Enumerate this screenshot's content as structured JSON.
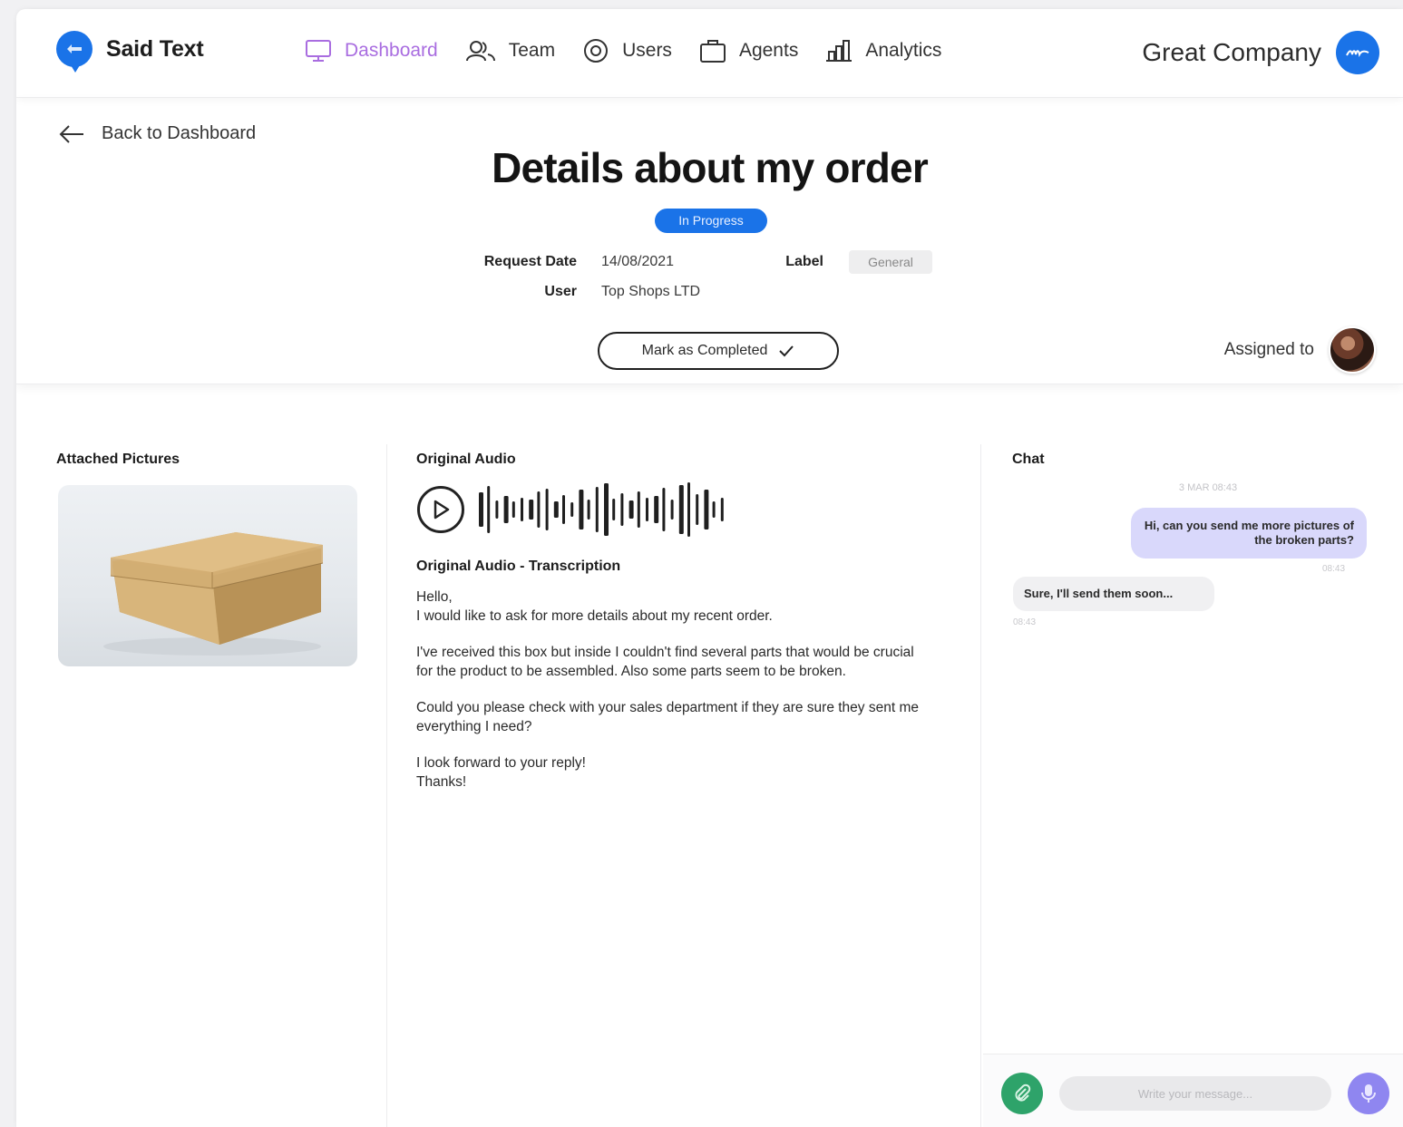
{
  "brand": {
    "name": "Said Text",
    "color": "#1a73e8"
  },
  "nav": {
    "items": [
      {
        "label": "Dashboard",
        "icon": "monitor-icon",
        "active": true
      },
      {
        "label": "Team",
        "icon": "team-icon"
      },
      {
        "label": "Users",
        "icon": "users-icon"
      },
      {
        "label": "Agents",
        "icon": "briefcase-icon"
      },
      {
        "label": "Analytics",
        "icon": "bar-chart-icon"
      }
    ],
    "active_color": "#a96de0"
  },
  "company": {
    "name": "Great Company"
  },
  "header": {
    "back_label": "Back to Dashboard",
    "title": "Details about my order",
    "status": "In Progress",
    "meta": {
      "request_date_label": "Request Date",
      "request_date": "14/08/2021",
      "label_label": "Label",
      "label_value": "General",
      "user_label": "User",
      "user_value": "Top Shops LTD"
    },
    "complete_button": "Mark as Completed",
    "assigned_label": "Assigned to"
  },
  "pictures": {
    "title": "Attached Pictures"
  },
  "audio": {
    "title": "Original Audio",
    "transcription_title": "Original Audio - Transcription",
    "transcription": [
      "Hello,",
      "I would like to ask for more details about my recent order.",
      "I've received this box but inside I couldn't find several parts that would be crucial for the product to be assembled. Also some parts seem to be broken.",
      "Could you please check with your sales department if they are sure they sent me everything I need?",
      "I look forward to your reply!",
      "Thanks!"
    ]
  },
  "chat": {
    "title": "Chat",
    "date": "3 MAR 08:43",
    "messages": [
      {
        "from": "agent",
        "text": "Hi, can you send me more pictures of the broken parts?",
        "time": "08:43"
      },
      {
        "from": "user",
        "text": "Sure, I'll send them soon...",
        "time": "08:43"
      }
    ],
    "input_placeholder": "Write your message...",
    "colors": {
      "outgoing": "#d9d8fb",
      "incoming": "#f0f0f2",
      "attach": "#2ea36a",
      "mic": "#8f86f0"
    }
  }
}
